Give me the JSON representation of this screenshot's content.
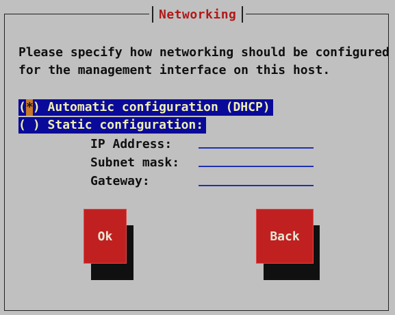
{
  "dialog": {
    "title": "Networking",
    "intro_line1": "Please specify how networking should be configured",
    "intro_line2": "for the management interface on this host."
  },
  "options": [
    {
      "marker": "*",
      "label": "Automatic configuration (DHCP)",
      "selected": true
    },
    {
      "marker": " ",
      "label": "Static configuration:",
      "selected": false
    }
  ],
  "fields": {
    "ip_label": "IP Address:",
    "ip_value": "",
    "subnet_label": "Subnet mask:",
    "subnet_value": "",
    "gateway_label": "Gateway:",
    "gateway_value": ""
  },
  "buttons": {
    "ok_label": "Ok",
    "back_label": "Back"
  },
  "colors": {
    "background": "#c0c0c0",
    "title": "#b01818",
    "selection_bar": "#0a0a9a",
    "selection_text": "#f0f0b0",
    "button": "#c02020",
    "field_line": "#2030b0"
  }
}
